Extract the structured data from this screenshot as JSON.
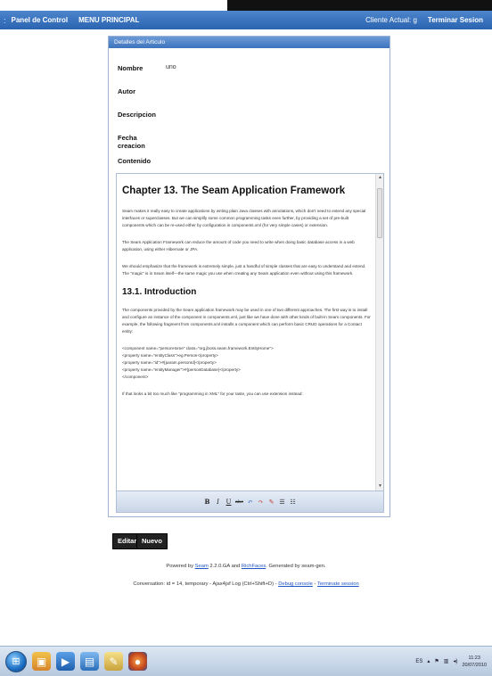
{
  "menubar": {
    "dots": ":",
    "panel_de_control": "Panel de Control",
    "menu_principal": "MENU PRINCIPAL",
    "cliente_actual": "Cliente Actual: g",
    "terminar_sesion": "Terminar Sesion"
  },
  "panel": {
    "header": "Detalles del Articulo",
    "fields": [
      {
        "label": "Nombre",
        "value": "uno"
      },
      {
        "label": "Autor",
        "value": ""
      },
      {
        "label": "Descripcion",
        "value": ""
      },
      {
        "label": "Fecha creacion",
        "value": ""
      },
      {
        "label": "Contenido",
        "value": ""
      }
    ]
  },
  "editor": {
    "h1": "Chapter 13. The Seam Application Framework",
    "p1": "Seam makes it really easy to create applications by writing plain Java classes with annotations, which don't need to extend any special interfaces or superclasses. But we can simplify some common programming tasks even further, by providing a set of pre-built components which can be re-used either by configuration in components.xml (for very simple cases) or extension.",
    "p2": "The Seam Application Framework can reduce the amount of code you need to write when doing basic database access in a web application, using either Hibernate or JPA.",
    "p3": "We should emphasize that the framework is extremely simple, just a handful of simple classes that are easy to understand and extend. The \"magic\" is in Seam itself—the same magic you use when creating any Seam application even without using this framework.",
    "h2": "13.1. Introduction",
    "p4": "The components provided by the Seam application framework may be used in one of two different approaches. The first way is to install and configure an instance of the component in components.xml, just like we have done with other kinds of built-in Seam components. For example, the following fragment from components.xml installs a component which can perform basic CRUD operations for a Contact entity:",
    "code": [
      "<component name=\"personHome\" class=\"org.jboss.seam.framework.EntityHome\">",
      "    <property name=\"entityClass\">eg.Person</property>",
      "    <property name=\"id\">#{param.personId}</property>",
      "    <property name=\"entityManager\">#{personDatabase}</property>",
      "</component>"
    ],
    "p5": "If that looks a bit too much like \"programming in XML\" for your taste, you can use extension instead:",
    "toolbar": {
      "bold": "B",
      "italic": "I",
      "underline": "U",
      "strike": "abc",
      "undo": "↶",
      "redo": "↷",
      "clean": "✎",
      "bullets": "☰",
      "numbers": "☷"
    }
  },
  "buttons": {
    "editar": "Editar",
    "nuevo": "Nuevo"
  },
  "footer": {
    "powered_by": "Powered by",
    "seam": "Seam",
    "seam_version": "2.2.0.GA and",
    "richfaces": "RichFaces",
    "generated": ". Generated by seam-gen.",
    "conversation": "Conversation: id = 14, temporary - Ajax4jsf Log (Ctrl+Shift+D) -",
    "debug_console": "Debug console",
    "sep": "-",
    "terminate_session": "Terminate session"
  },
  "taskbar": {
    "language": "ES",
    "time": "11:23",
    "date": "20/07/2010"
  }
}
